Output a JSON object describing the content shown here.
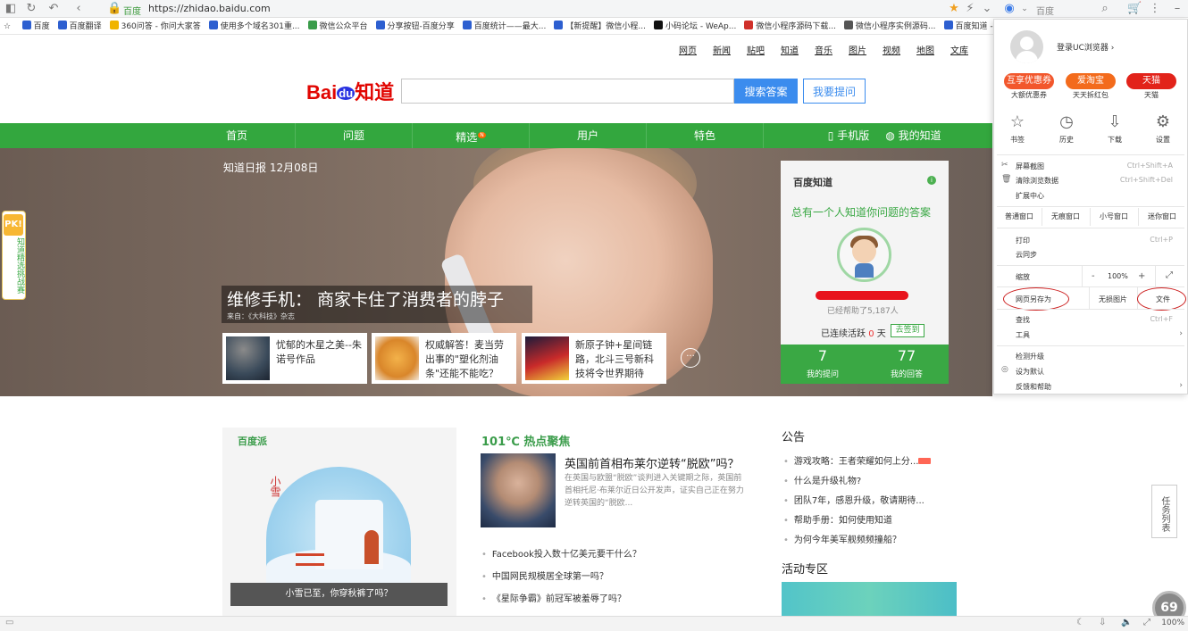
{
  "browser": {
    "site_label": "百度",
    "url": "https://zhidao.baidu.com",
    "search_placeholder": "百度",
    "zoom": "100%"
  },
  "bookmarks": [
    {
      "label": "百度",
      "color": "#2d5fd0"
    },
    {
      "label": "百度翻译",
      "color": "#2d5fd0"
    },
    {
      "label": "360问答 - 你问大家答",
      "color": "#f0b400"
    },
    {
      "label": "使用多个域名301重...",
      "color": "#2d5fd0"
    },
    {
      "label": "微信公众平台",
      "color": "#3a9c4a"
    },
    {
      "label": "分享按钮-百度分享",
      "color": "#2d5fd0"
    },
    {
      "label": "百度统计——最大...",
      "color": "#2d5fd0"
    },
    {
      "label": "【新提醒】微信小程...",
      "color": "#2d5fd0"
    },
    {
      "label": "小码论坛 - WeAp...",
      "color": "#111111"
    },
    {
      "label": "微信小程序源码下载...",
      "color": "#d0302a"
    },
    {
      "label": "微信小程序实例源码...",
      "color": "#555555"
    },
    {
      "label": "百度知道 - 全球最...",
      "color": "#2d5fd0"
    }
  ],
  "toplinks": [
    "网页",
    "新闻",
    "贴吧",
    "知道",
    "音乐",
    "图片",
    "视频",
    "地图",
    "文库"
  ],
  "logo": {
    "text_a": "Bai",
    "text_b": "du",
    "text_c": "知道"
  },
  "search": {
    "submit": "搜索答案",
    "ask": "我要提问"
  },
  "nav": {
    "items": [
      "首页",
      "问题",
      "精选",
      "用户",
      "特色"
    ],
    "badge": "N",
    "mobile": "手机版",
    "mine": "我的知道"
  },
  "hero": {
    "date": "知道日报 12月08日",
    "headline": "维修手机： 商家卡住了消费者的脖子",
    "source": "来自：《大科技》杂志",
    "cards": [
      "忧郁的木星之美--朱诺号作品",
      "权威解答！麦当劳出事的\"塑化剂油条\"还能不能吃？",
      "新原子钟+星间链路，北斗三号新科技将令世界期待"
    ],
    "more": "···"
  },
  "panel": {
    "title": "百度知道",
    "slogan": "总有一个人知道你问题的答案",
    "helped": "已经帮助了5,187人",
    "active_prefix": "已连续活跃",
    "active_days": "0",
    "active_suffix": "天",
    "signin": "去签到",
    "questions_count": "7",
    "questions_label": "我的提问",
    "answers_count": "77",
    "answers_label": "我的回答"
  },
  "pk": {
    "badge": "PK!",
    "text": "知道精选挑战赛"
  },
  "baidupai": {
    "logo": "百度派",
    "vtext": "小雪",
    "caption": "小雪已至，你穿秋裤了吗？"
  },
  "hot": {
    "title": "101℃ 热点聚焦",
    "headline": "英国前首相布莱尔逆转“脱欧”吗？",
    "summary": "在英国与欧盟“脱欧”谈判进入关键期之际，英国前首相托尼·布莱尔近日公开发声，证实自己正在努力逆转英国的“脱欧...",
    "items": [
      "Facebook投入数十亿美元要干什么？",
      "中国网民规模居全球第一吗？",
      "《星际争霸》前冠军被羞辱了吗？"
    ]
  },
  "notice": {
    "title": "公告",
    "items": [
      "游戏攻略：王者荣耀如何上分...",
      "什么是升级礼物?",
      "团队7年，感恩升级，敬请期待...",
      "帮助手册：如何使用知道",
      "为何今年美军舰频频撞船？"
    ]
  },
  "activity": {
    "title": "活动专区"
  },
  "tasks": "任务列表",
  "watermark": "69",
  "ucmenu": {
    "login": "登录UC浏览器",
    "promos": [
      {
        "label": "互享优惠券",
        "caption": "大额优惠券",
        "color": "#f2572c"
      },
      {
        "label": "爱淘宝",
        "caption": "天天拆红包",
        "color": "#f36b1c"
      },
      {
        "label": "天猫",
        "caption": "天猫",
        "color": "#e2231a"
      }
    ],
    "quick": [
      "书签",
      "历史",
      "下载",
      "设置"
    ],
    "items1": [
      {
        "label": "屏幕截图",
        "shortcut": "Ctrl+Shift+A"
      },
      {
        "label": "清除浏览数据",
        "shortcut": "Ctrl+Shift+Del"
      },
      {
        "label": "扩展中心",
        "shortcut": ""
      }
    ],
    "windows": [
      "普通窗口",
      "无痕窗口",
      "小号窗口",
      "迷你窗口"
    ],
    "items2": [
      {
        "label": "打印",
        "shortcut": "Ctrl+P"
      },
      {
        "label": "云同步",
        "shortcut": ""
      }
    ],
    "zoom_label": "缩放",
    "zoom_minus": "-",
    "zoom_value": "100%",
    "zoom_plus": "+",
    "save_as": [
      "网页另存为",
      "无损图片",
      "文件"
    ],
    "items3": [
      {
        "label": "查找",
        "shortcut": "Ctrl+F"
      },
      {
        "label": "工具",
        "shortcut": "›"
      }
    ],
    "items4": [
      {
        "label": "检测升级",
        "shortcut": ""
      },
      {
        "label": "设为默认",
        "shortcut": ""
      },
      {
        "label": "反馈和帮助",
        "shortcut": "›"
      }
    ]
  }
}
